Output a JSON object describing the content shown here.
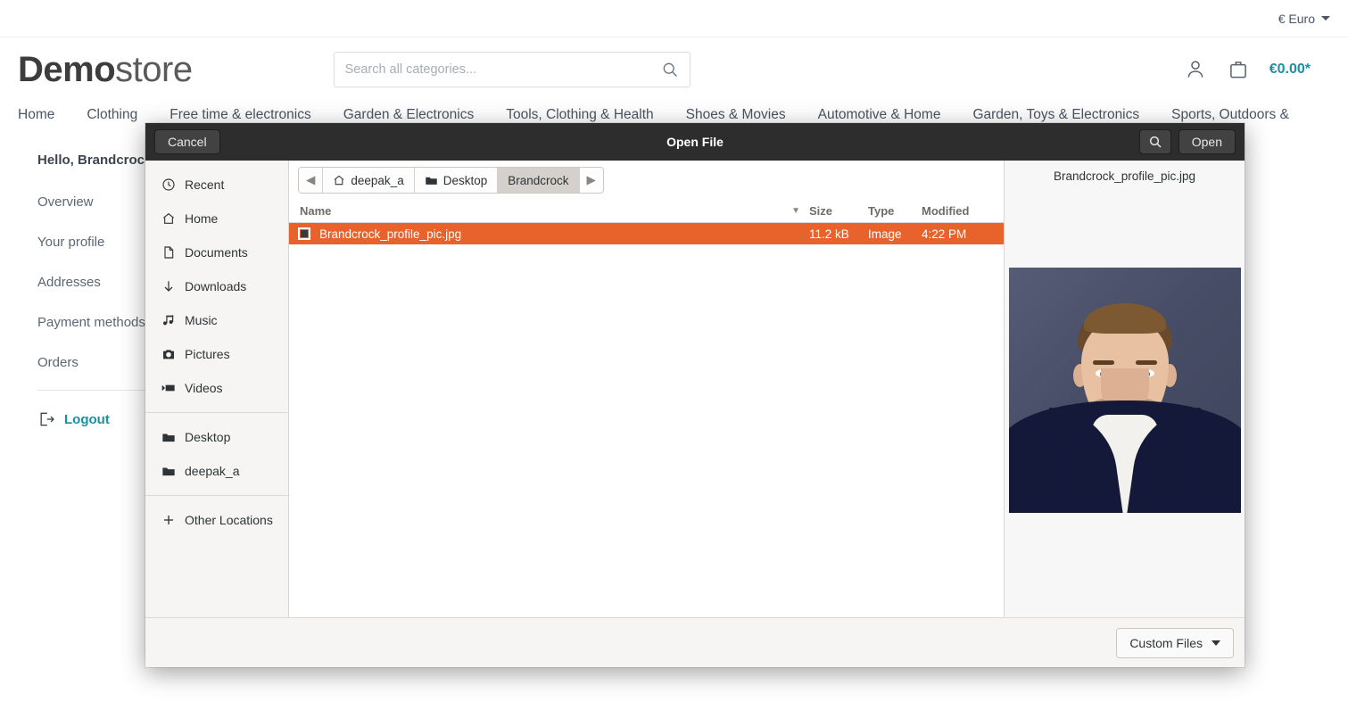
{
  "shop": {
    "topbar": {
      "currency_label": "€ Euro"
    },
    "logo": {
      "bold": "Demo",
      "light": "store"
    },
    "search": {
      "placeholder": "Search all categories...",
      "value": ""
    },
    "header_right": {
      "cart_total": "€0.00*"
    },
    "nav": [
      "Home",
      "Clothing",
      "Free time & electronics",
      "Garden & Electronics",
      "Tools, Clothing & Health",
      "Shoes & Movies",
      "Automotive & Home",
      "Garden, Toys & Electronics",
      "Sports, Outdoors &"
    ],
    "account": {
      "greeting": "Hello, Brandcrock Brandcrock",
      "links": [
        "Overview",
        "Your profile",
        "Addresses",
        "Payment methods",
        "Orders"
      ],
      "logout_label": "Logout"
    }
  },
  "dialog": {
    "title": "Open File",
    "cancel_label": "Cancel",
    "open_label": "Open",
    "search_icon": "search-icon",
    "places": [
      {
        "label": "Recent",
        "icon": "clock-icon"
      },
      {
        "label": "Home",
        "icon": "home-icon"
      },
      {
        "label": "Documents",
        "icon": "document-icon"
      },
      {
        "label": "Downloads",
        "icon": "download-arrow-icon"
      },
      {
        "label": "Music",
        "icon": "music-note-icon"
      },
      {
        "label": "Pictures",
        "icon": "camera-icon"
      },
      {
        "label": "Videos",
        "icon": "video-icon"
      },
      {
        "label": "Desktop",
        "icon": "folder-icon"
      },
      {
        "label": "deepak_a",
        "icon": "folder-icon"
      },
      {
        "label": "Other Locations",
        "icon": "plus-icon"
      }
    ],
    "breadcrumb": [
      {
        "label": "deepak_a",
        "icon": "home-icon",
        "active": false
      },
      {
        "label": "Desktop",
        "icon": "folder-icon",
        "active": false
      },
      {
        "label": "Brandcrock",
        "icon": "",
        "active": true
      }
    ],
    "columns": [
      "Name",
      "Size",
      "Type",
      "Modified"
    ],
    "files": [
      {
        "name": "Brandcrock_profile_pic.jpg",
        "size": "11.2 kB",
        "type": "Image",
        "modified": "4:22 PM",
        "selected": true
      }
    ],
    "preview": {
      "filename": "Brandcrock_profile_pic.jpg"
    },
    "footer": {
      "filter_label": "Custom Files"
    },
    "selection_color": "#e8622b",
    "header_color": "#2d2d2d"
  }
}
